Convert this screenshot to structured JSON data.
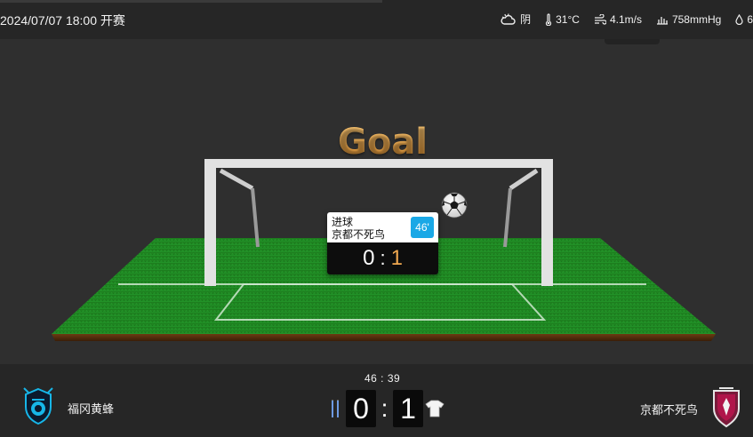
{
  "header": {
    "match_time": "2024/07/07 18:00 开赛",
    "weather": {
      "condition": "阴",
      "condition_icon": "cloudy-icon",
      "temperature": "31°C",
      "temperature_icon": "thermometer-icon",
      "wind": "4.1m/s",
      "wind_icon": "wind-icon",
      "pressure": "758mmHg",
      "pressure_icon": "pressure-icon",
      "humidity": "6",
      "humidity_icon": "droplet-icon"
    }
  },
  "scene": {
    "title": "Goal",
    "event": {
      "type": "进球",
      "team": "京都不死鸟",
      "minute": "46'",
      "score_home": "0",
      "score_sep": ":",
      "score_away": "1"
    }
  },
  "footer": {
    "clock": "46 : 39",
    "home": {
      "name": "福冈黄蜂",
      "score": "0",
      "kit_color": "#2f6fd8"
    },
    "away": {
      "name": "京都不死鸟",
      "score": "1",
      "kit_color": "#ffffff"
    },
    "score_sep": ":"
  },
  "colors": {
    "goal_title": "#f0a850",
    "minute_badge": "#1aa8e6",
    "away_score": "#f0a850",
    "grass": "#1f8a1f"
  }
}
